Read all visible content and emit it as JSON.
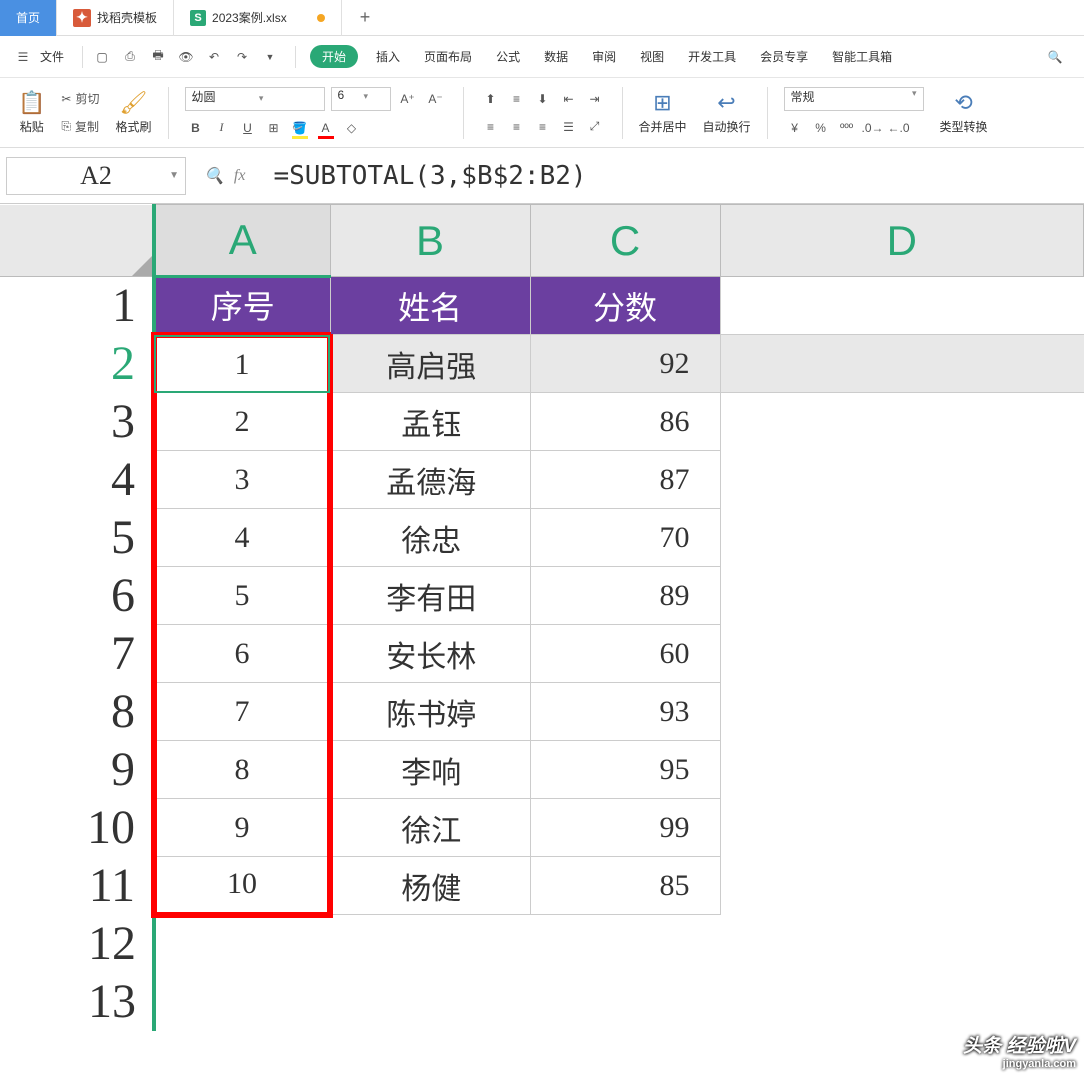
{
  "tabs": {
    "home": "首页",
    "templates": "找稻壳模板",
    "file": "2023案例.xlsx"
  },
  "menu": {
    "file": "文件",
    "start": "开始",
    "insert": "插入",
    "layout": "页面布局",
    "formula": "公式",
    "data": "数据",
    "review": "审阅",
    "view": "视图",
    "dev": "开发工具",
    "member": "会员专享",
    "smart": "智能工具箱"
  },
  "toolbar": {
    "paste": "粘贴",
    "cut": "剪切",
    "copy": "复制",
    "format_painter": "格式刷",
    "font_name": "幼圆",
    "font_size": "6",
    "merge": "合并居中",
    "wrap": "自动换行",
    "num_format": "常规",
    "type_convert": "类型转换"
  },
  "cell": {
    "ref": "A2",
    "formula": "=SUBTOTAL(3,$B$2:B2)"
  },
  "columns": [
    "A",
    "B",
    "C",
    "D"
  ],
  "headers": {
    "a": "序号",
    "b": "姓名",
    "c": "分数"
  },
  "rows": [
    {
      "n": "1"
    },
    {
      "n": "2",
      "a": "1",
      "b": "高启强",
      "c": "92"
    },
    {
      "n": "3",
      "a": "2",
      "b": "孟钰",
      "c": "86"
    },
    {
      "n": "4",
      "a": "3",
      "b": "孟德海",
      "c": "87"
    },
    {
      "n": "5",
      "a": "4",
      "b": "徐忠",
      "c": "70"
    },
    {
      "n": "6",
      "a": "5",
      "b": "李有田",
      "c": "89"
    },
    {
      "n": "7",
      "a": "6",
      "b": "安长林",
      "c": "60"
    },
    {
      "n": "8",
      "a": "7",
      "b": "陈书婷",
      "c": "93"
    },
    {
      "n": "9",
      "a": "8",
      "b": "李响",
      "c": "95"
    },
    {
      "n": "10",
      "a": "9",
      "b": "徐江",
      "c": "99"
    },
    {
      "n": "11",
      "a": "10",
      "b": "杨健",
      "c": "85"
    },
    {
      "n": "12"
    },
    {
      "n": "13"
    }
  ],
  "watermark": {
    "line1": "头条 经验啦V",
    "line2": "jingyanla.com"
  }
}
